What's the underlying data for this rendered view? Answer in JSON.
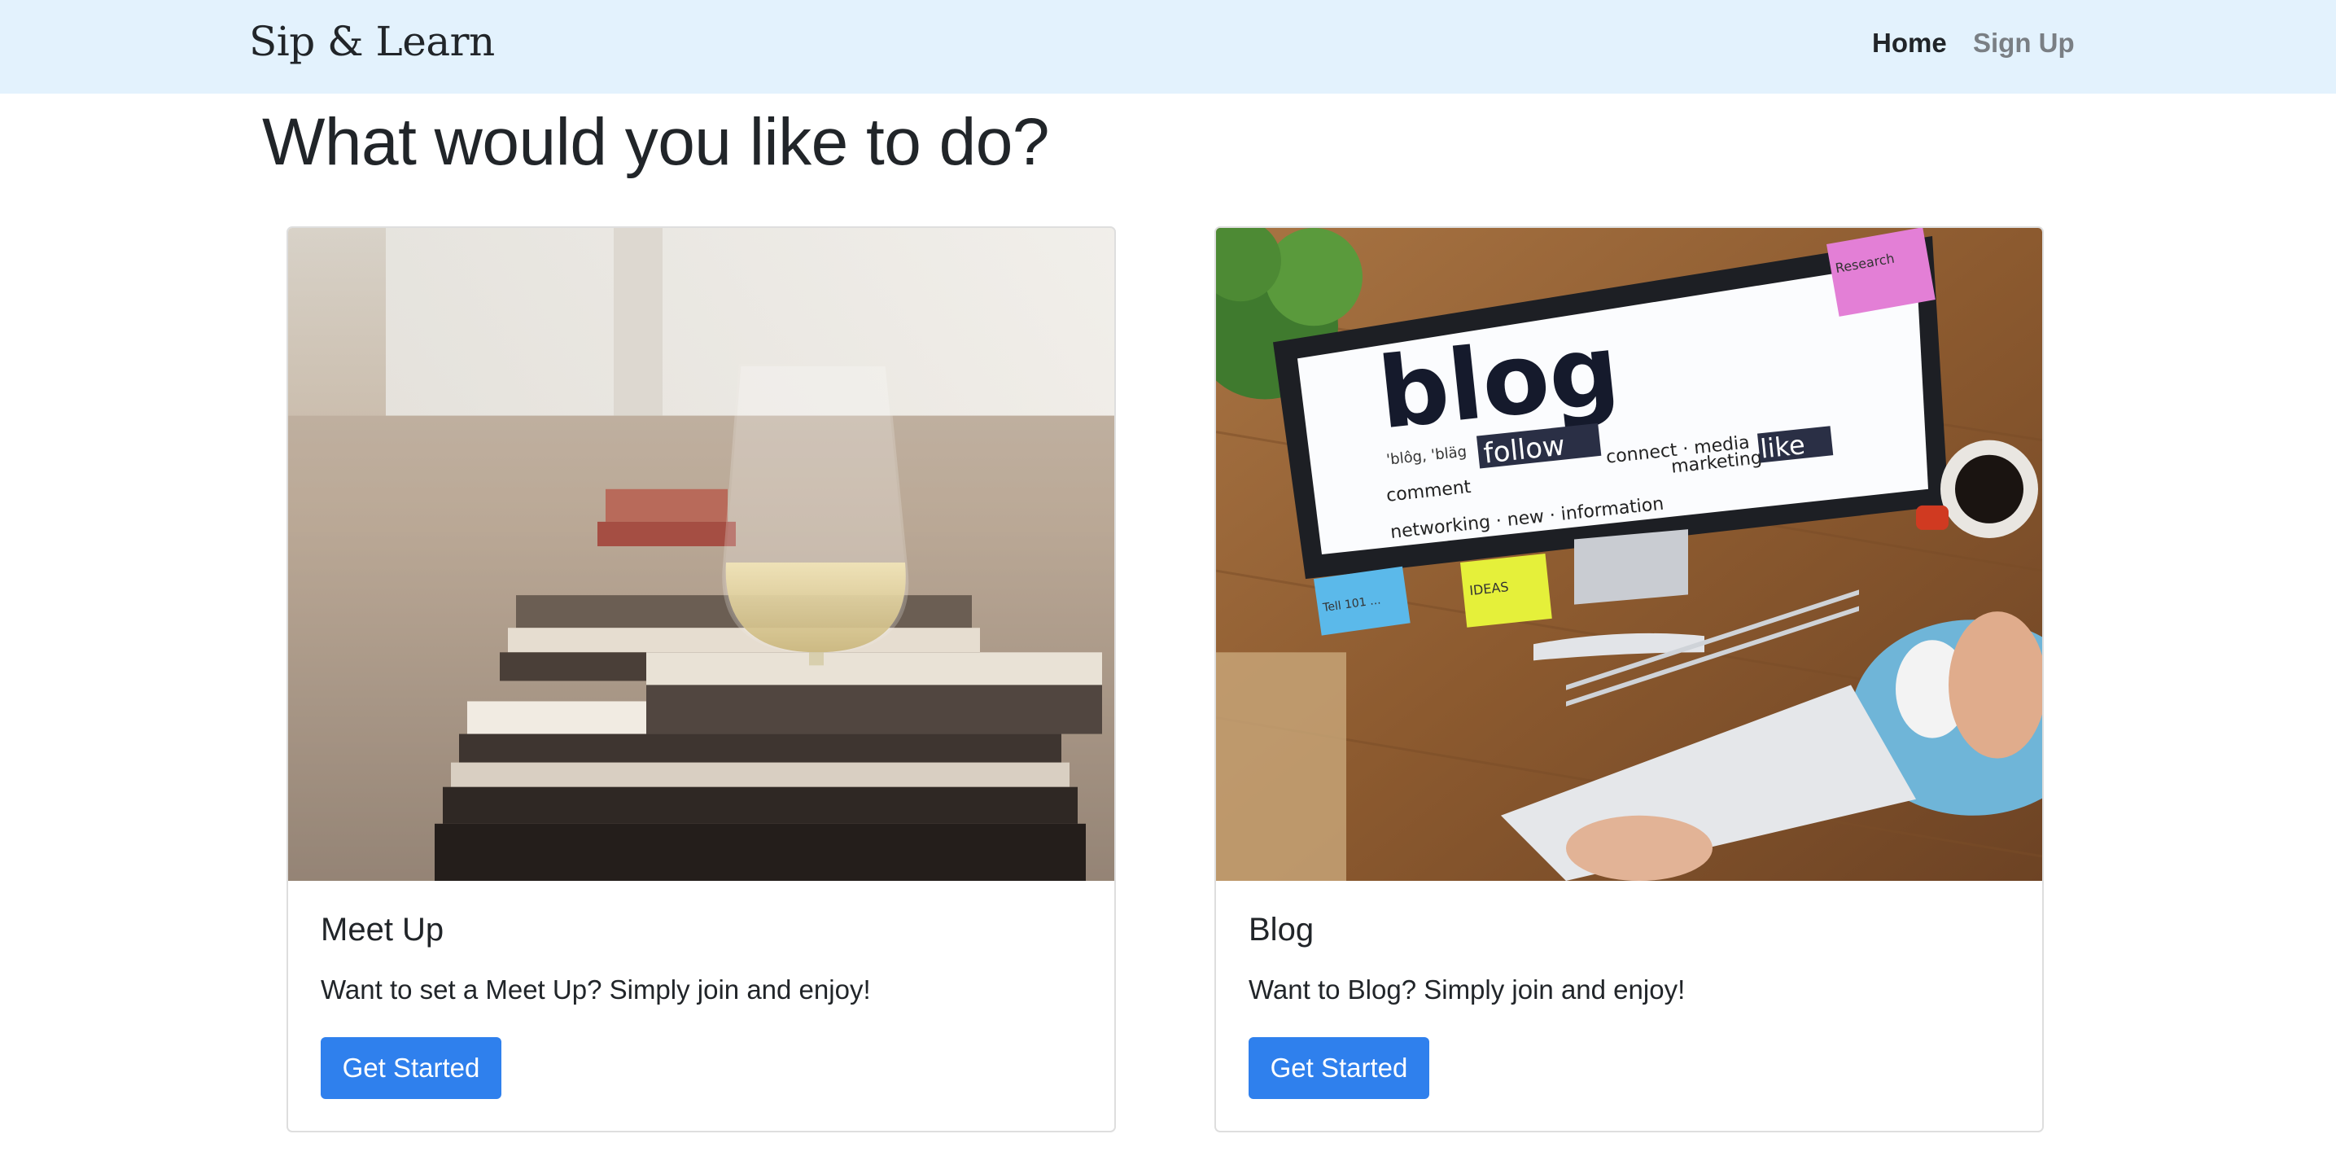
{
  "navbar": {
    "brand": "Sip & Learn",
    "links": [
      {
        "label": "Home",
        "active": true
      },
      {
        "label": "Sign Up",
        "active": false
      }
    ],
    "background": "#e3f2fd"
  },
  "page": {
    "title": "What would you like to do?"
  },
  "cards": [
    {
      "title": "Meet Up",
      "text": "Want to set a Meet Up? Simply join and enjoy!",
      "button_label": "Get Started",
      "image": {
        "subject": "wine-glass-on-books"
      }
    },
    {
      "title": "Blog",
      "text": "Want to Blog? Simply join and enjoy!",
      "button_label": "Get Started",
      "image": {
        "subject": "blog-desk-computer",
        "screen_word": "blog",
        "screen_phonetic": "'blôg, 'bläg",
        "screen_words": [
          "comment",
          "follow",
          "connect",
          "media",
          "marketing",
          "like",
          "networking",
          "new",
          "information"
        ],
        "sticky_notes": [
          "Research",
          "IDEAS",
          "Tell 101 ..."
        ]
      }
    }
  ],
  "colors": {
    "primary_button": "#2f80ed",
    "text": "#212529",
    "muted_link": "#7a7f84"
  }
}
